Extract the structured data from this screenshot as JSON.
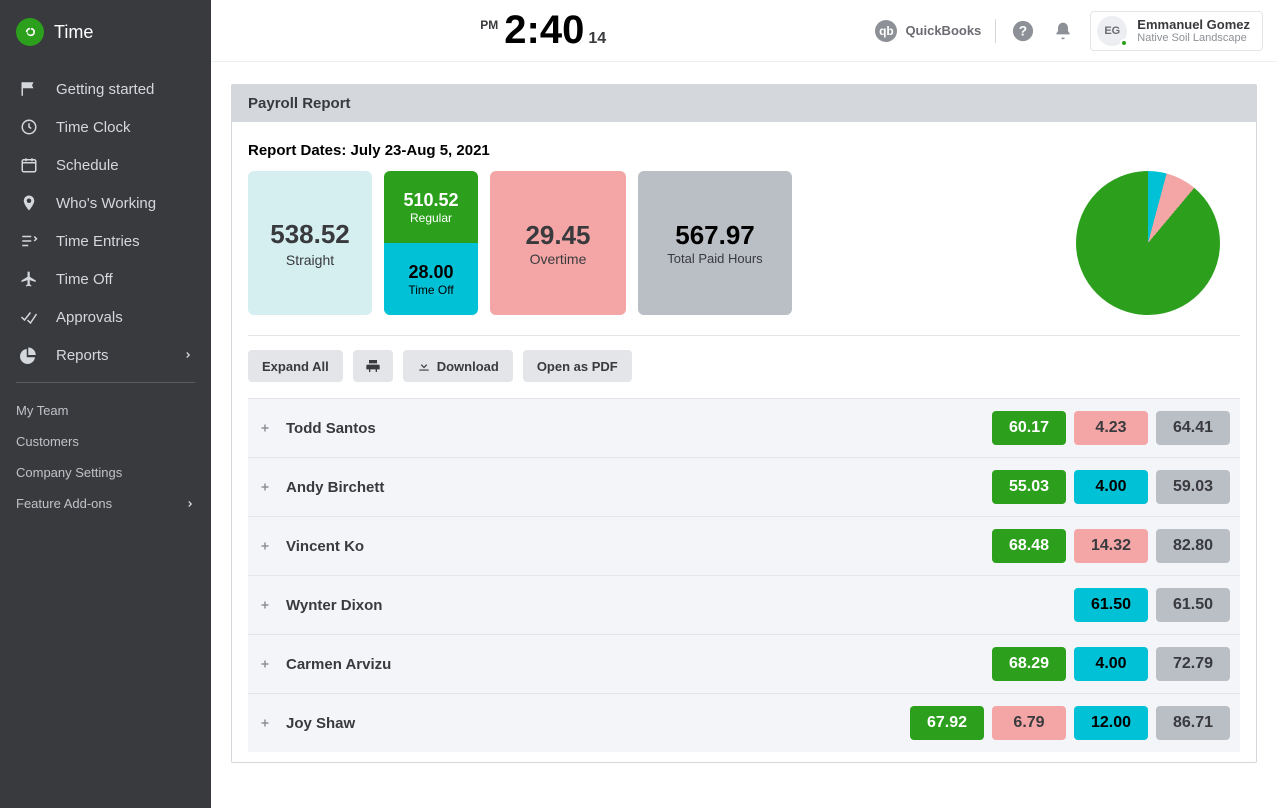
{
  "app": {
    "name": "Time"
  },
  "clock": {
    "ampm": "PM",
    "time": "2:40",
    "seconds": "14"
  },
  "topbar": {
    "quickbooks_label": "QuickBooks",
    "user_initials": "EG",
    "user_name": "Emmanuel Gomez",
    "user_org": "Native Soil Landscape"
  },
  "sidebar": {
    "items": [
      {
        "label": "Getting started"
      },
      {
        "label": "Time Clock"
      },
      {
        "label": "Schedule"
      },
      {
        "label": "Who's Working"
      },
      {
        "label": "Time Entries"
      },
      {
        "label": "Time Off"
      },
      {
        "label": "Approvals"
      },
      {
        "label": "Reports"
      }
    ],
    "secondary": [
      {
        "label": "My Team"
      },
      {
        "label": "Customers"
      },
      {
        "label": "Company Settings"
      },
      {
        "label": "Feature Add-ons"
      }
    ]
  },
  "report": {
    "title": "Payroll Report",
    "dates": "Report Dates: July 23-Aug 5, 2021",
    "summary": {
      "straight": {
        "value": "538.52",
        "label": "Straight"
      },
      "regular": {
        "value": "510.52",
        "label": "Regular"
      },
      "timeoff": {
        "value": "28.00",
        "label": "Time Off"
      },
      "overtime": {
        "value": "29.45",
        "label": "Overtime"
      },
      "total": {
        "value": "567.97",
        "label": "Total Paid Hours"
      }
    },
    "toolbar": {
      "expand_all": "Expand All",
      "download": "Download",
      "open_pdf": "Open as PDF"
    },
    "rows": [
      {
        "name": "Todd Santos",
        "regular": "60.17",
        "overtime": "4.23",
        "timeoff": null,
        "total": "64.41"
      },
      {
        "name": "Andy Birchett",
        "regular": "55.03",
        "overtime": null,
        "timeoff": "4.00",
        "total": "59.03"
      },
      {
        "name": "Vincent Ko",
        "regular": "68.48",
        "overtime": "14.32",
        "timeoff": null,
        "total": "82.80"
      },
      {
        "name": "Wynter Dixon",
        "regular": null,
        "overtime": null,
        "timeoff": "61.50",
        "total": "61.50"
      },
      {
        "name": "Carmen Arvizu",
        "regular": "68.29",
        "overtime": null,
        "timeoff": "4.00",
        "total": "72.79"
      },
      {
        "name": "Joy Shaw",
        "regular": "67.92",
        "overtime": "6.79",
        "timeoff": "12.00",
        "total": "86.71"
      }
    ]
  },
  "chart_data": {
    "type": "pie",
    "title": "Hours breakdown",
    "series": [
      {
        "name": "Regular",
        "value": 510.52,
        "color": "#2ca01c"
      },
      {
        "name": "Time Off",
        "value": 28.0,
        "color": "#00c1d5"
      },
      {
        "name": "Overtime",
        "value": 29.45,
        "color": "#f4a6a6"
      }
    ]
  }
}
